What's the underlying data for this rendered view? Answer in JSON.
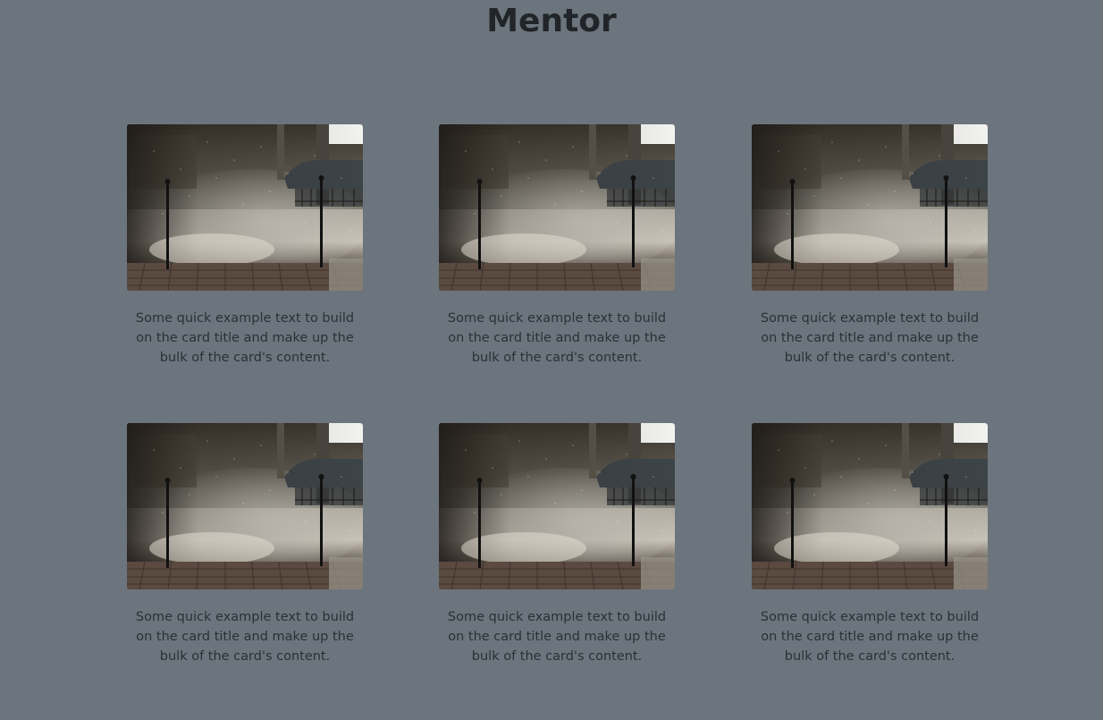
{
  "page": {
    "title": "Mentor"
  },
  "colors": {
    "background": "#6c757d",
    "title": "#212529",
    "card_text": "#2b3035"
  },
  "cards": [
    {
      "image": "rainy-street-photo",
      "text": "Some quick example text to build on the card title and make up the bulk of the card's content."
    },
    {
      "image": "rainy-street-photo",
      "text": "Some quick example text to build on the card title and make up the bulk of the card's content."
    },
    {
      "image": "rainy-street-photo",
      "text": "Some quick example text to build on the card title and make up the bulk of the card's content."
    },
    {
      "image": "rainy-street-photo",
      "text": "Some quick example text to build on the card title and make up the bulk of the card's content."
    },
    {
      "image": "rainy-street-photo",
      "text": "Some quick example text to build on the card title and make up the bulk of the card's content."
    },
    {
      "image": "rainy-street-photo",
      "text": "Some quick example text to build on the card title and make up the bulk of the card's content."
    }
  ]
}
